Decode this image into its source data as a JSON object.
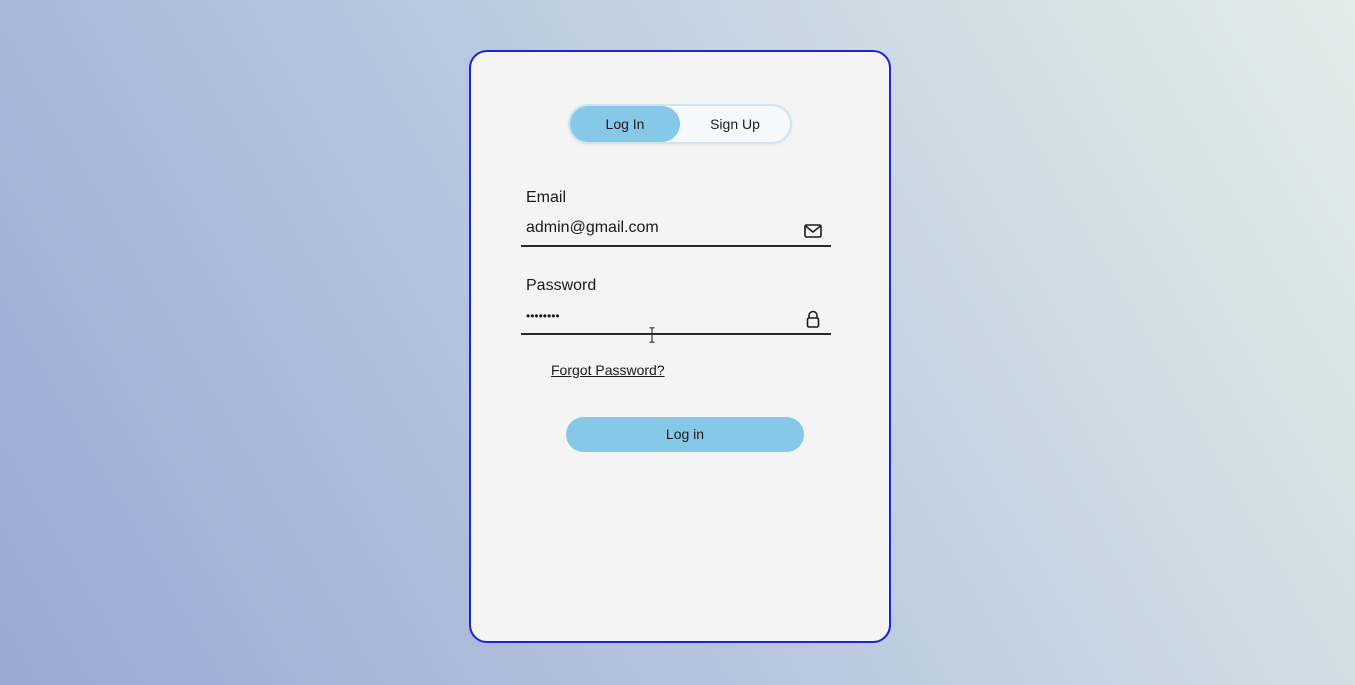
{
  "auth_toggle": {
    "login_label": "Log In",
    "signup_label": "Sign Up",
    "active": "login"
  },
  "email": {
    "label": "Email",
    "value": "admin@gmail.com",
    "icon": "mail-icon"
  },
  "password": {
    "label": "Password",
    "value": "••••••••",
    "icon": "lock-icon"
  },
  "forgot_password": {
    "label": "Forgot Password?"
  },
  "submit": {
    "label": "Log in"
  },
  "colors": {
    "accent": "#86c8e8",
    "card_border": "#1f23d6",
    "card_background": "#f4f4f5"
  }
}
